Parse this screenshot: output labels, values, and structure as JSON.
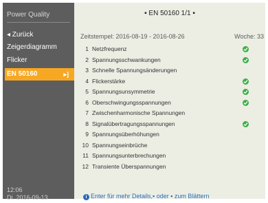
{
  "sidebar": {
    "header": "Power Quality",
    "items": [
      {
        "label": "◂ Zurück"
      },
      {
        "label": "Zeigerdiagramm"
      },
      {
        "label": "Flicker"
      }
    ],
    "active_item": {
      "label": "EN 50160",
      "arrow": "▸]"
    },
    "footer": {
      "time": "12:06",
      "date": "Di. 2016-09-13"
    }
  },
  "panel": {
    "title": "▪  EN 50160 1/1  ▪",
    "timestamp": "Zeitstempel: 2016-08-19 - 2016-08-26",
    "week": "Woche: 33",
    "hint": "Enter für mehr Details,▪ oder ▪ zum Blättern",
    "rows": [
      {
        "num": "1",
        "label": "Netzfrequenz",
        "ok": true
      },
      {
        "num": "2",
        "label": "Spannungsschwankungen",
        "ok": true
      },
      {
        "num": "3",
        "label": "Schnelle Spannungsänderungen",
        "ok": false
      },
      {
        "num": "4",
        "label": "Flickerstärke",
        "ok": true
      },
      {
        "num": "5",
        "label": "Spannungsunsymmetrie",
        "ok": true
      },
      {
        "num": "6",
        "label": "Oberschwingungsspannungen",
        "ok": true
      },
      {
        "num": "7",
        "label": "Zwischenharmonische Spannungen",
        "ok": false
      },
      {
        "num": "8",
        "label": "Signalübertragungsspannungen",
        "ok": true
      },
      {
        "num": "9",
        "label": "Spannungsüberhöhungen",
        "ok": false
      },
      {
        "num": "10",
        "label": "Spannungseinbrüche",
        "ok": false
      },
      {
        "num": "11",
        "label": "Spannungsunterbrechungen",
        "ok": false
      },
      {
        "num": "12",
        "label": "Transiente Überspannungen",
        "ok": false
      }
    ]
  },
  "colors": {
    "sidebar_bg": "#5d5d5d",
    "active_bg": "#f7a823",
    "panel_bg": "#eceee4",
    "check_green": "#3fae49",
    "hint_blue": "#2b6bb5"
  },
  "icons": {
    "check": "check-circle-icon",
    "info": "info-icon"
  }
}
